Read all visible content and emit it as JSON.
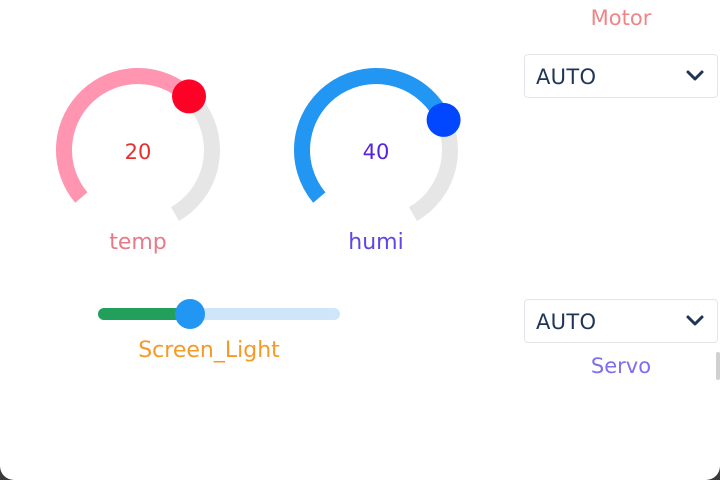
{
  "colors": {
    "temp_track": "#e6e6e6",
    "temp_arc": "#ff95b0",
    "temp_knob": "#ff0026",
    "temp_value": "#e63030",
    "temp_label": "#e87a88",
    "humi_track": "#e6e6e6",
    "humi_arc": "#2196f3",
    "humi_knob": "#0047ff",
    "humi_value": "#5722e0",
    "humi_label": "#5b47e6",
    "motor_label": "#f08585",
    "servo_label": "#7e6ef0",
    "light_label": "#f49a28"
  },
  "gauges": [
    {
      "id": "temp",
      "value": "20",
      "label": "temp",
      "level": 0.62
    },
    {
      "id": "humi",
      "value": "40",
      "label": "humi",
      "level": 0.7
    }
  ],
  "motor": {
    "label": "Motor",
    "selected": "AUTO",
    "icon": "chevron-down-icon"
  },
  "servo": {
    "label": "Servo",
    "selected": "AUTO",
    "icon": "chevron-down-icon"
  },
  "screen_light": {
    "label": "Screen_Light",
    "level": 0.38
  }
}
